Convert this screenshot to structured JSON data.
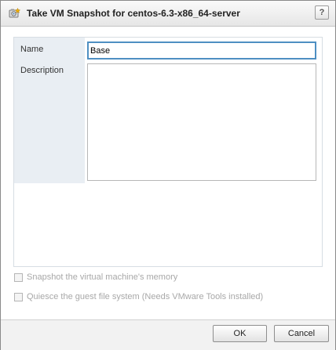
{
  "window": {
    "title": "Take VM Snapshot for centos-6.3-x86_64-server",
    "title_icon": "snapshot-icon",
    "help_icon": "help-icon",
    "help_label": "?"
  },
  "form": {
    "name_label": "Name",
    "name_value": "Base",
    "description_label": "Description",
    "description_value": ""
  },
  "options": {
    "snapshot_memory_label": "Snapshot the virtual machine's memory",
    "snapshot_memory_checked": false,
    "snapshot_memory_enabled": false,
    "quiesce_label": "Quiesce the guest file system (Needs VMware Tools installed)",
    "quiesce_checked": false,
    "quiesce_enabled": false
  },
  "footer": {
    "ok_label": "OK",
    "cancel_label": "Cancel"
  },
  "colors": {
    "focus_border": "#4e8fc2",
    "label_column": "#e9eef3",
    "disabled_text": "#a8a8a8"
  }
}
